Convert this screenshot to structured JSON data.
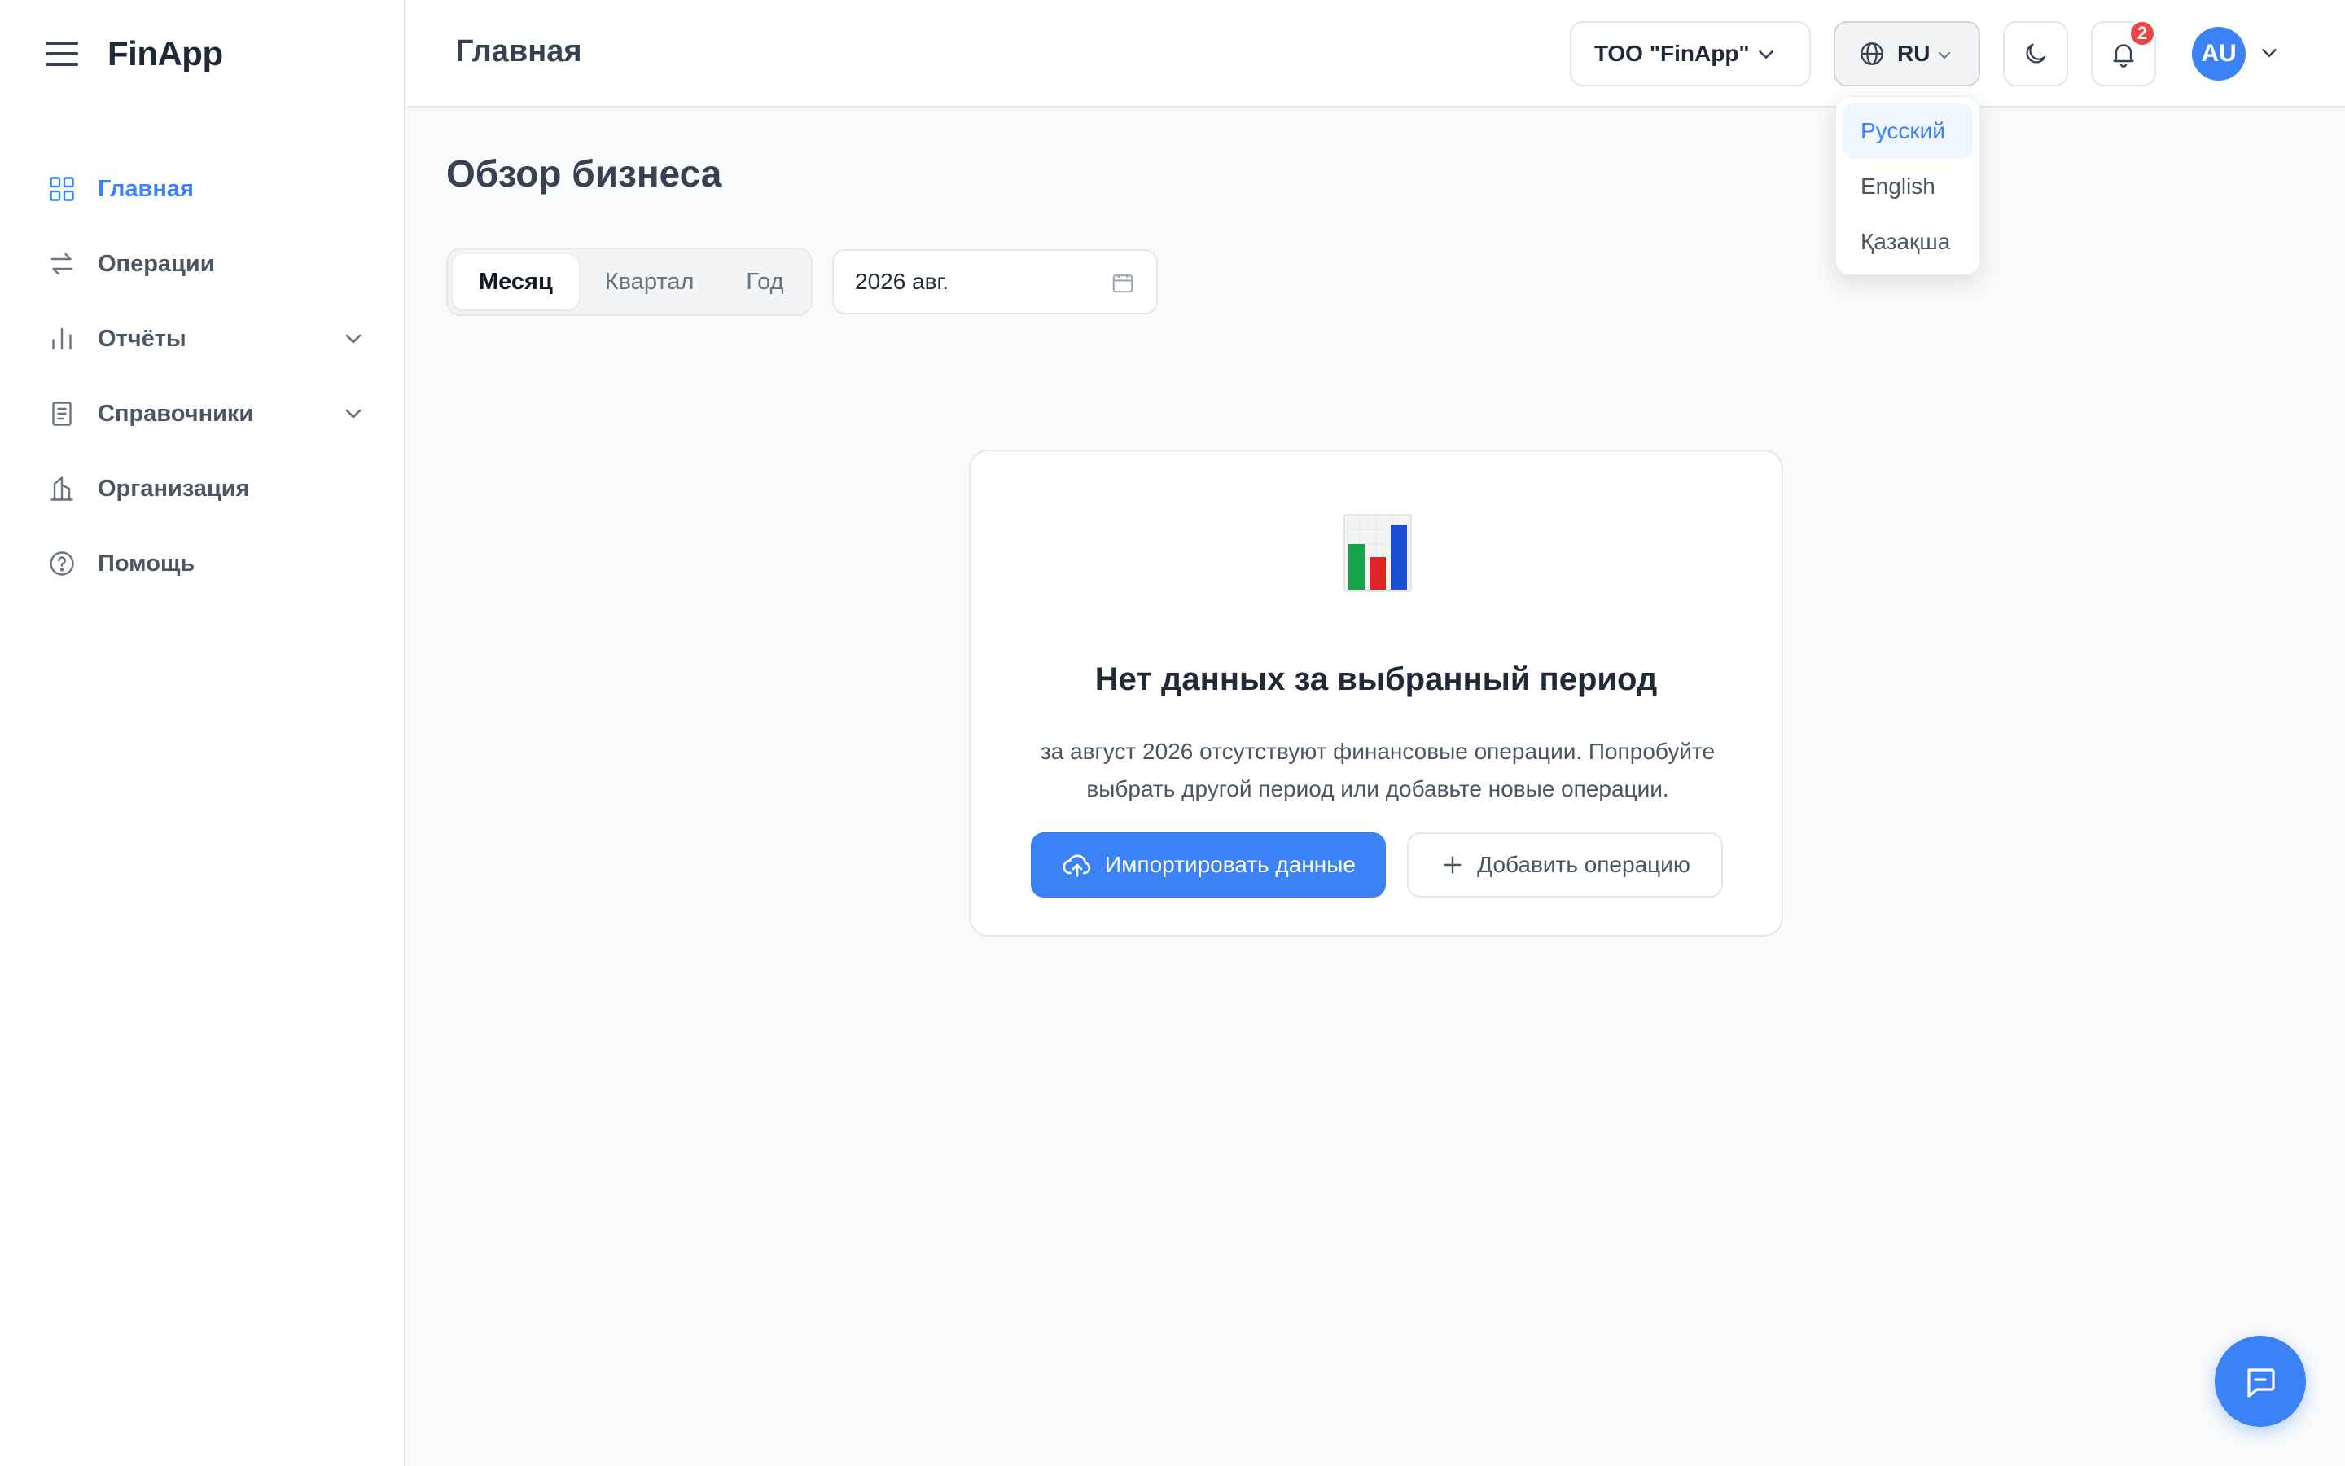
{
  "app": {
    "name": "FinApp"
  },
  "sidebar": {
    "items": [
      {
        "label": "Главная",
        "icon": "grid-icon",
        "active": true
      },
      {
        "label": "Операции",
        "icon": "transfer-arrows-icon"
      },
      {
        "label": "Отчёты",
        "icon": "bar-chart-icon",
        "expandable": true
      },
      {
        "label": "Справочники",
        "icon": "book-icon",
        "expandable": true
      },
      {
        "label": "Организация",
        "icon": "building-icon"
      },
      {
        "label": "Помощь",
        "icon": "help-circle-icon"
      }
    ]
  },
  "header": {
    "title": "Главная",
    "organization": "ТОО \"FinApp\"",
    "language": "RU",
    "notifications_count": "2",
    "avatar_initials": "AU"
  },
  "language_menu": {
    "options": [
      "Русский",
      "English",
      "Қазақша"
    ],
    "selected": "Русский"
  },
  "main": {
    "title": "Обзор бизнеса",
    "period_tabs": [
      "Месяц",
      "Квартал",
      "Год"
    ],
    "active_tab": "Месяц",
    "date_value": "2026 авг."
  },
  "empty_state": {
    "title": "Нет данных за выбранный период",
    "description": "за август 2026 отсутствуют финансовые операции. Попробуйте выбрать другой период или добавьте новые операции.",
    "import_label": "Импортировать данные",
    "add_label": "Добавить операцию"
  },
  "colors": {
    "accent": "#3b82f6",
    "badge": "#ef4444",
    "text": "#1f2937"
  }
}
